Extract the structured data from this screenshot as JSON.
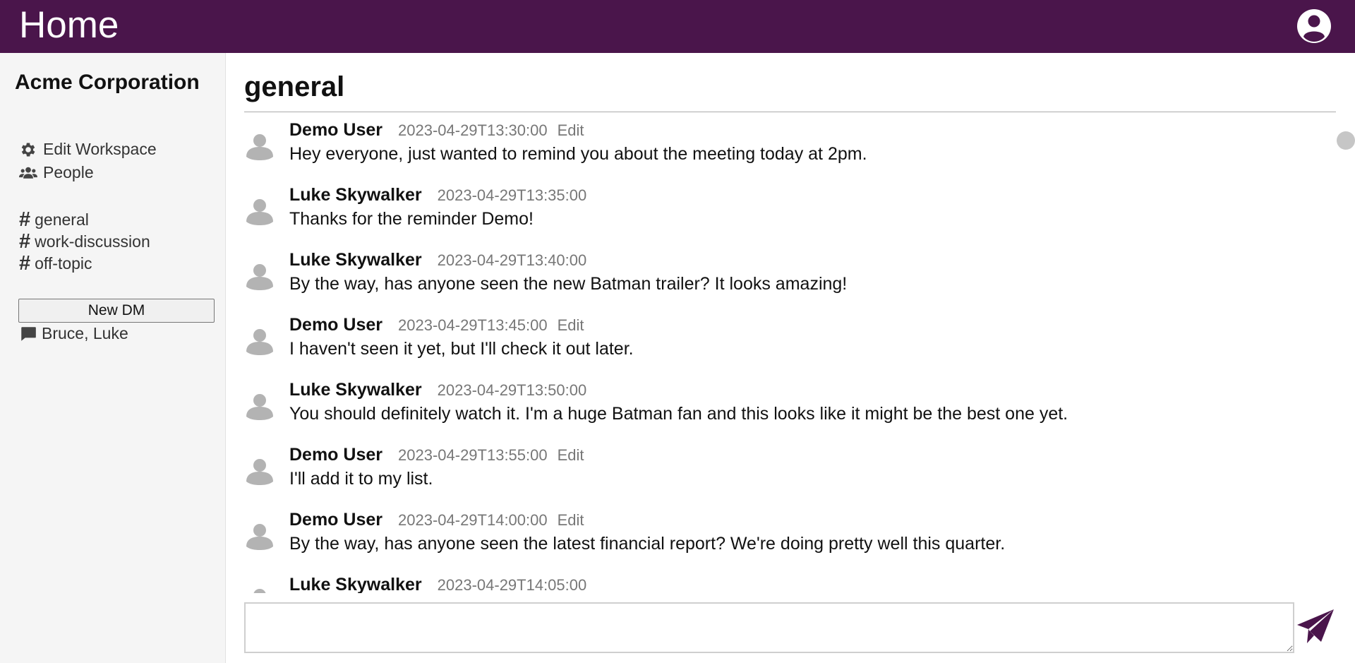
{
  "header": {
    "title": "Home",
    "account_icon": "account-circle-icon"
  },
  "sidebar": {
    "workspace_name": "Acme Corporation",
    "links": [
      {
        "label": "Edit Workspace",
        "icon": "gear-icon"
      },
      {
        "label": "People",
        "icon": "people-icon"
      }
    ],
    "channels": [
      "general",
      "work-discussion",
      "off-topic"
    ],
    "new_dm_label": "New DM",
    "dms": [
      {
        "label": "Bruce, Luke",
        "icon": "chat-bubble-icon"
      }
    ]
  },
  "channel": {
    "title": "general",
    "messages": [
      {
        "author": "Demo User",
        "time": "2023-04-29T13:30:00",
        "edit": "Edit",
        "text": "Hey everyone, just wanted to remind you about the meeting today at 2pm."
      },
      {
        "author": "Luke Skywalker",
        "time": "2023-04-29T13:35:00",
        "edit": "",
        "text": "Thanks for the reminder Demo!"
      },
      {
        "author": "Luke Skywalker",
        "time": "2023-04-29T13:40:00",
        "edit": "",
        "text": "By the way, has anyone seen the new Batman trailer? It looks amazing!"
      },
      {
        "author": "Demo User",
        "time": "2023-04-29T13:45:00",
        "edit": "Edit",
        "text": "I haven't seen it yet, but I'll check it out later."
      },
      {
        "author": "Luke Skywalker",
        "time": "2023-04-29T13:50:00",
        "edit": "",
        "text": "You should definitely watch it. I'm a huge Batman fan and this looks like it might be the best one yet."
      },
      {
        "author": "Demo User",
        "time": "2023-04-29T13:55:00",
        "edit": "Edit",
        "text": "I'll add it to my list."
      },
      {
        "author": "Demo User",
        "time": "2023-04-29T14:00:00",
        "edit": "Edit",
        "text": "By the way, has anyone seen the latest financial report? We're doing pretty well this quarter."
      },
      {
        "author": "Luke Skywalker",
        "time": "2023-04-29T14:05:00",
        "edit": "",
        "text": ""
      }
    ]
  },
  "composer": {
    "value": "",
    "placeholder": "",
    "send_icon": "send-paper-plane-icon"
  },
  "colors": {
    "brand": "#4a154b",
    "sidebar_bg": "#f5f5f5",
    "muted": "#777777"
  }
}
